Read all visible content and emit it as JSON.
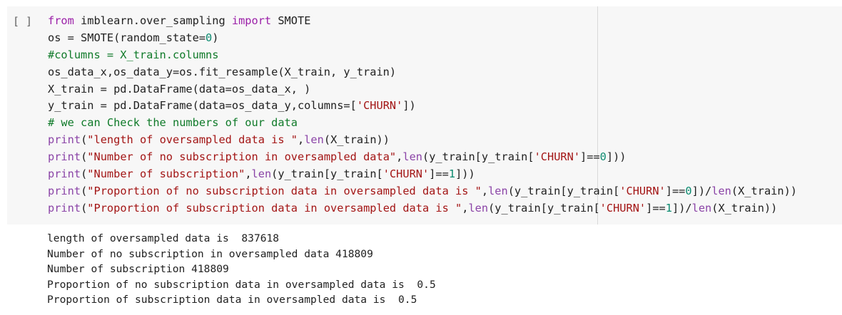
{
  "cell": {
    "run_button": "[ ]",
    "code_lines": [
      [
        {
          "t": "kw",
          "v": "from"
        },
        {
          "t": "p",
          "v": " imblearn.over_sampling "
        },
        {
          "t": "kw",
          "v": "import"
        },
        {
          "t": "p",
          "v": " SMOTE"
        }
      ],
      [
        {
          "t": "p",
          "v": "os = SMOTE(random_state="
        },
        {
          "t": "num",
          "v": "0"
        },
        {
          "t": "p",
          "v": ")"
        }
      ],
      [
        {
          "t": "cm",
          "v": "#columns = X_train.columns"
        }
      ],
      [
        {
          "t": "p",
          "v": "os_data_x,os_data_y=os.fit_resample(X_train, y_train)"
        }
      ],
      [
        {
          "t": "p",
          "v": "X_train = pd.DataFrame(data=os_data_x, )"
        }
      ],
      [
        {
          "t": "p",
          "v": "y_train = pd.DataFrame(data=os_data_y,columns=["
        },
        {
          "t": "str",
          "v": "'CHURN'"
        },
        {
          "t": "p",
          "v": "])"
        }
      ],
      [
        {
          "t": "cm",
          "v": "# we can Check the numbers of our data"
        }
      ],
      [
        {
          "t": "bi",
          "v": "print"
        },
        {
          "t": "p",
          "v": "("
        },
        {
          "t": "str",
          "v": "\"length of oversampled data is \""
        },
        {
          "t": "p",
          "v": ","
        },
        {
          "t": "bi",
          "v": "len"
        },
        {
          "t": "p",
          "v": "(X_train))"
        }
      ],
      [
        {
          "t": "bi",
          "v": "print"
        },
        {
          "t": "p",
          "v": "("
        },
        {
          "t": "str",
          "v": "\"Number of no subscription in oversampled data\""
        },
        {
          "t": "p",
          "v": ","
        },
        {
          "t": "bi",
          "v": "len"
        },
        {
          "t": "p",
          "v": "(y_train[y_train["
        },
        {
          "t": "str",
          "v": "'CHURN'"
        },
        {
          "t": "p",
          "v": "]=="
        },
        {
          "t": "num",
          "v": "0"
        },
        {
          "t": "p",
          "v": "]))"
        }
      ],
      [
        {
          "t": "bi",
          "v": "print"
        },
        {
          "t": "p",
          "v": "("
        },
        {
          "t": "str",
          "v": "\"Number of subscription\""
        },
        {
          "t": "p",
          "v": ","
        },
        {
          "t": "bi",
          "v": "len"
        },
        {
          "t": "p",
          "v": "(y_train[y_train["
        },
        {
          "t": "str",
          "v": "'CHURN'"
        },
        {
          "t": "p",
          "v": "]=="
        },
        {
          "t": "num",
          "v": "1"
        },
        {
          "t": "p",
          "v": "]))"
        }
      ],
      [
        {
          "t": "bi",
          "v": "print"
        },
        {
          "t": "p",
          "v": "("
        },
        {
          "t": "str",
          "v": "\"Proportion of no subscription data in oversampled data is \""
        },
        {
          "t": "p",
          "v": ","
        },
        {
          "t": "bi",
          "v": "len"
        },
        {
          "t": "p",
          "v": "(y_train[y_train["
        },
        {
          "t": "str",
          "v": "'CHURN'"
        },
        {
          "t": "p",
          "v": "]=="
        },
        {
          "t": "num",
          "v": "0"
        },
        {
          "t": "p",
          "v": "])/"
        },
        {
          "t": "bi",
          "v": "len"
        },
        {
          "t": "p",
          "v": "(X_train))"
        }
      ],
      [
        {
          "t": "bi",
          "v": "print"
        },
        {
          "t": "p",
          "v": "("
        },
        {
          "t": "str",
          "v": "\"Proportion of subscription data in oversampled data is \""
        },
        {
          "t": "p",
          "v": ","
        },
        {
          "t": "bi",
          "v": "len"
        },
        {
          "t": "p",
          "v": "(y_train[y_train["
        },
        {
          "t": "str",
          "v": "'CHURN'"
        },
        {
          "t": "p",
          "v": "]=="
        },
        {
          "t": "num",
          "v": "1"
        },
        {
          "t": "p",
          "v": "])/"
        },
        {
          "t": "bi",
          "v": "len"
        },
        {
          "t": "p",
          "v": "(X_train))"
        }
      ]
    ],
    "output_lines": [
      "length of oversampled data is  837618",
      "Number of no subscription in oversampled data 418809",
      "Number of subscription 418809",
      "Proportion of no subscription data in oversampled data is  0.5",
      "Proportion of subscription data in oversampled data is  0.5"
    ]
  },
  "colors": {
    "code_background": "#f7f7f7",
    "keyword": "#9b1fa8",
    "builtin": "#8b44a7",
    "string": "#a31515",
    "number": "#0b8a6f",
    "comment": "#0f7a29",
    "text": "#212121"
  }
}
